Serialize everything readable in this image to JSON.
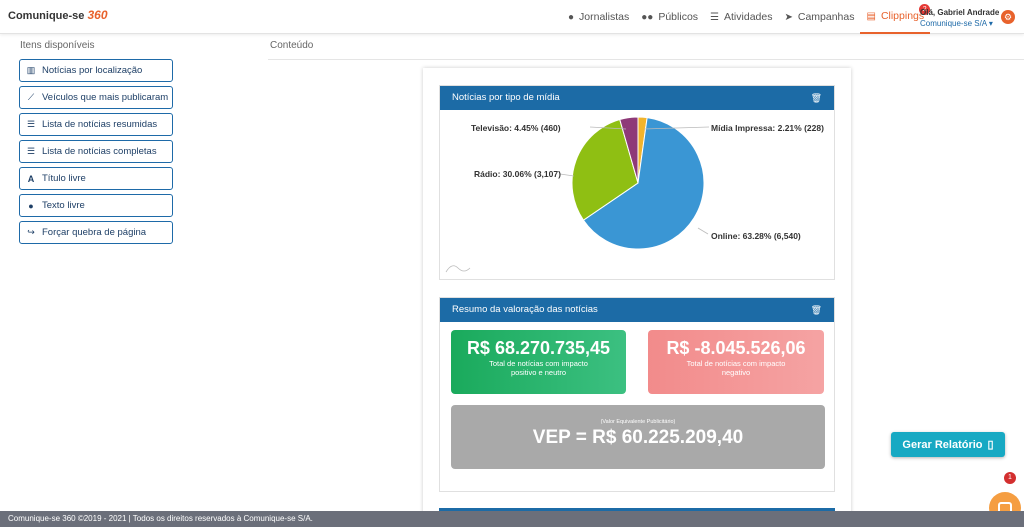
{
  "header": {
    "logo_text": "Comunique-se",
    "logo_num": "360",
    "nav": [
      {
        "label": "Jornalistas",
        "icon": "person-icon"
      },
      {
        "label": "Públicos",
        "icon": "group-icon"
      },
      {
        "label": "Atividades",
        "icon": "list-icon"
      },
      {
        "label": "Campanhas",
        "icon": "send-icon"
      },
      {
        "label": "Clippings",
        "icon": "newspaper-icon",
        "badge": "2"
      }
    ],
    "user_greeting": "Olá, Gabriel Andrade",
    "user_org": "Comunique-se S/A ▾"
  },
  "left": {
    "title": "Itens disponíveis",
    "items": [
      {
        "label": "Notícias por localização",
        "icon": "bar-chart-icon"
      },
      {
        "label": "Veículos que mais publicaram",
        "icon": "line-chart-icon"
      },
      {
        "label": "Lista de notícias resumidas",
        "icon": "list-icon"
      },
      {
        "label": "Lista de notícias completas",
        "icon": "list-icon"
      },
      {
        "label": "Título livre",
        "icon": "font-icon"
      },
      {
        "label": "Texto livre",
        "icon": "comment-icon"
      },
      {
        "label": "Forçar quebra de página",
        "icon": "share-icon"
      }
    ]
  },
  "content": {
    "title": "Conteúdo",
    "pie_panel_title": "Notícias por tipo de mídia",
    "valuation_panel_title": "Resumo da valoração das notícias",
    "positive_value": "R$ 68.270.735,45",
    "positive_label": "Total de notícias com impacto positivo e neutro",
    "negative_value": "R$ -8.045.526,06",
    "negative_label": "Total de notícias com impacto negativo",
    "vep_note": "(Valor Equivalente Publicitário)",
    "vep_value": "VEP = R$ 60.225.209,40"
  },
  "chart_data": {
    "type": "pie",
    "slices": [
      {
        "name": "Online",
        "percent": 63.28,
        "count": 6540,
        "label": "Online: 63.28% (6,540)",
        "color": "#3a96d4"
      },
      {
        "name": "Rádio",
        "percent": 30.06,
        "count": 3107,
        "label": "Rádio: 30.06% (3,107)",
        "color": "#8fbf13"
      },
      {
        "name": "Televisão",
        "percent": 4.45,
        "count": 460,
        "label": "Televisão: 4.45% (460)",
        "color": "#8e3a78"
      },
      {
        "name": "Mídia Impressa",
        "percent": 2.21,
        "count": 228,
        "label": "Mídia Impressa: 2.21% (228)",
        "color": "#f2b42c"
      }
    ]
  },
  "actions": {
    "generate_report": "Gerar Relatório",
    "chat_badge": "1"
  },
  "footer": {
    "text": "Comunique-se 360 ©2019 - 2021 | Todos os direitos reservados à Comunique-se S/A."
  }
}
